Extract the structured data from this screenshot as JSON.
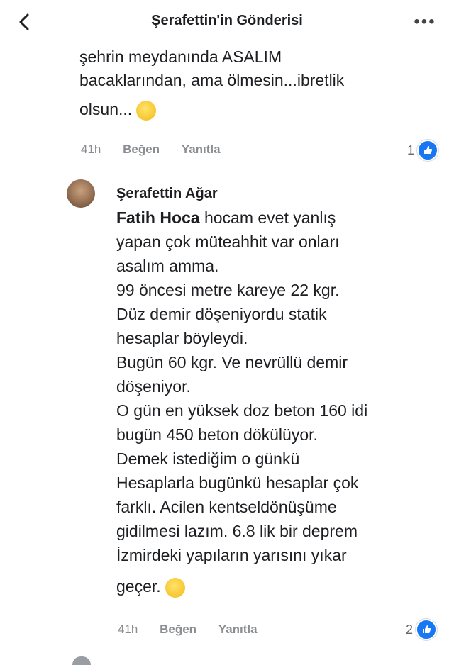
{
  "header": {
    "title": "Şerafettin'in Gönderisi",
    "back_icon": "chevron-left-icon",
    "more_icon": "more-horizontal-icon",
    "more_label": "•••"
  },
  "comment1": {
    "lines": [
      "şehrin meydanında ASALIM",
      "bacaklarından, ama ölmesin...ibretlik",
      "olsun..."
    ],
    "emoji": "face-emoji",
    "time": "41h",
    "like_label": "Beğen",
    "reply_label": "Yanıtla",
    "reaction_count": "1",
    "reaction_icon": "like-icon"
  },
  "comment2": {
    "author": "Şerafettin Ağar",
    "mention": "Fatih Hoca",
    "lines": [
      "hocam evet yanlış",
      "yapan çok müteahhit var onları",
      "asalım amma.",
      "99 öncesi metre kareye 22 kgr.",
      "Düz demir döşeniyordu statik",
      "hesaplar böyleydi.",
      "Bugün 60 kgr. Ve nevrüllü demir",
      "döşeniyor.",
      "O gün en yüksek doz beton 160 idi",
      "bugün 450 beton dökülüyor.",
      "Demek istediğim o günkü",
      "Hesaplarla bugünkü hesaplar çok",
      "farklı. Acilen kentseldönüşüme",
      "gidilmesi lazım. 6.8 lik bir deprem",
      "İzmirdeki yapıların yarısını yıkar",
      "geçer."
    ],
    "emoji": "face-emoji",
    "time": "41h",
    "like_label": "Beğen",
    "reply_label": "Yanıtla",
    "reaction_count": "2",
    "reaction_icon": "like-icon"
  },
  "colors": {
    "accent": "#1877f2",
    "meta": "#8a8d91",
    "text": "#1c1e21"
  }
}
